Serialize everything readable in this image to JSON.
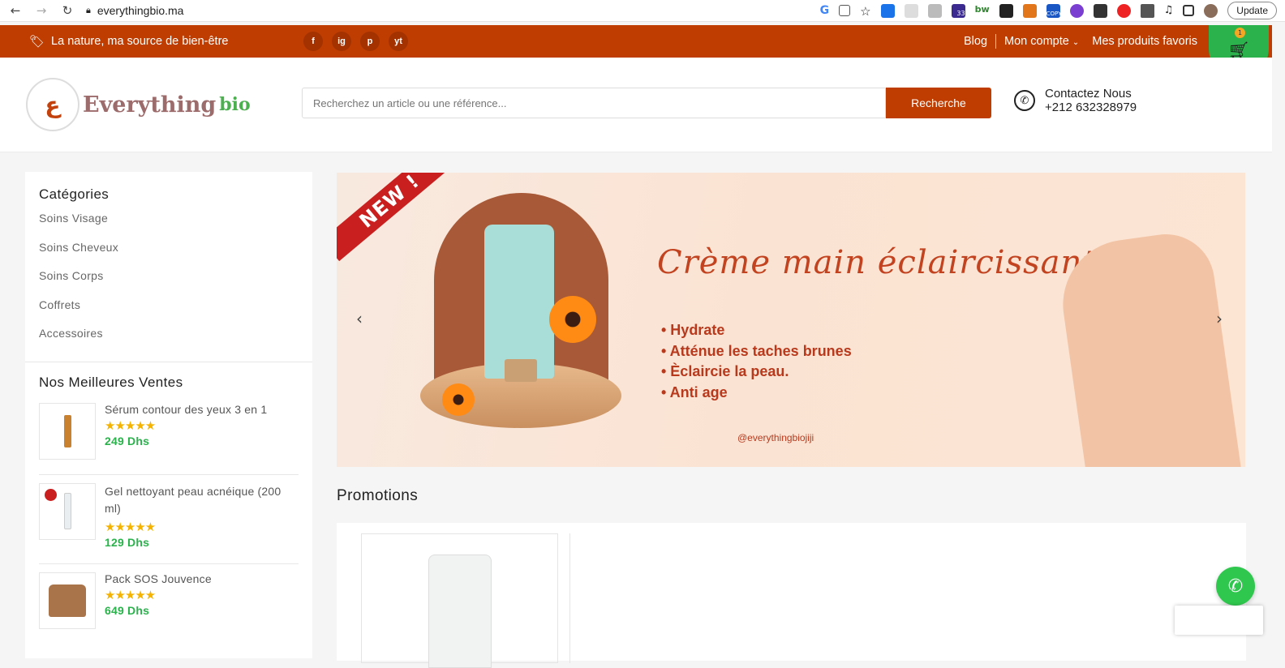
{
  "browser": {
    "url": "everythingbio.ma",
    "update_label": "Update",
    "ext_badge": "33",
    "ext_bw": "bw",
    "ext_copy": "COPY"
  },
  "topbar": {
    "tagline": "La nature, ma source de bien-être",
    "social": [
      "f",
      "ig",
      "p",
      "yt"
    ],
    "links": {
      "blog": "Blog",
      "account": "Mon compte",
      "favorites": "Mes produits favoris"
    },
    "cart_count": "1"
  },
  "header": {
    "logo_text": "Everything",
    "logo_bio": "bio",
    "search_placeholder": "Recherchez un article ou une référence...",
    "search_button": "Recherche",
    "contact_title": "Contactez Nous",
    "contact_phone": "+212 632328979"
  },
  "sidebar": {
    "categories_title": "Catégories",
    "categories": [
      "Soins Visage",
      "Soins Cheveux",
      "Soins Corps",
      "Coffrets",
      "Accessoires"
    ],
    "best_title": "Nos Meilleures Ventes",
    "best": [
      {
        "name": "Sérum contour des yeux 3 en 1",
        "rating": 5,
        "price": "249 Dhs"
      },
      {
        "name": "Gel nettoyant peau acnéique (200 ml)",
        "rating": 5,
        "price": "129 Dhs"
      },
      {
        "name": "Pack SOS Jouvence",
        "rating": 5,
        "price": "649 Dhs"
      }
    ]
  },
  "banner": {
    "ribbon": "NEW !",
    "title": "Crème main éclaircissante",
    "bullets": [
      "• Hydrate",
      "• Atténue  les taches brunes",
      "• Èclaircie la peau.",
      "• Anti age"
    ],
    "handle": "@everythingbiojiji",
    "prev": "‹",
    "next": "›"
  },
  "promotions": {
    "title": "Promotions"
  },
  "colors": {
    "brand": "#bf3d00",
    "green": "#2bb24c",
    "star": "#f5b301"
  }
}
